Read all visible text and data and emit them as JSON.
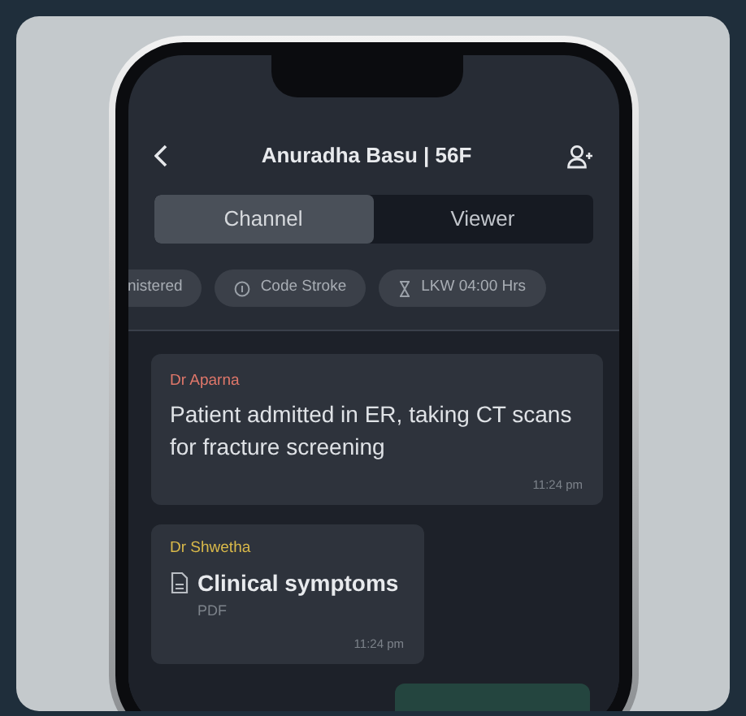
{
  "header": {
    "title": "Anuradha Basu | 56F"
  },
  "tabs": [
    {
      "label": "Channel",
      "selected": true
    },
    {
      "label": "Viewer",
      "selected": false
    }
  ],
  "chips": [
    {
      "label": "nistered",
      "kind": "plain"
    },
    {
      "label": "Code Stroke",
      "kind": "info"
    },
    {
      "label": "LKW 04:00 Hrs",
      "kind": "timer"
    }
  ],
  "messages": [
    {
      "kind": "text",
      "sender": "Dr Aparna",
      "color": "#e0776a",
      "text": "Patient admitted in ER, taking CT scans for fracture screening",
      "time": "11:24 pm"
    },
    {
      "kind": "file",
      "sender": "Dr Shwetha",
      "color": "#d9b94a",
      "text": "Clinical symptoms",
      "subtext": "PDF",
      "time": "11:24 pm"
    }
  ]
}
